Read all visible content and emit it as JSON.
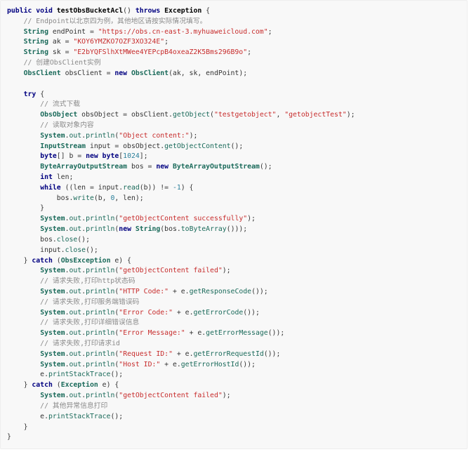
{
  "code": {
    "lines": [
      [
        {
          "t": "public void ",
          "c": "kw"
        },
        {
          "t": "testObsBucketAcl",
          "c": "fn"
        },
        {
          "t": "() ",
          "c": "pl"
        },
        {
          "t": "throws ",
          "c": "kw"
        },
        {
          "t": "Exception",
          "c": "fn"
        },
        {
          "t": " {",
          "c": "pl"
        }
      ],
      [
        {
          "t": "    // Endpoint以北京四为例，其他地区请按实际情况填写。",
          "c": "cmt"
        }
      ],
      [
        {
          "t": "    ",
          "c": "pl"
        },
        {
          "t": "String",
          "c": "ty"
        },
        {
          "t": " endPoint = ",
          "c": "pl"
        },
        {
          "t": "\"https://obs.cn-east-3.myhuaweicloud.com\"",
          "c": "str"
        },
        {
          "t": ";",
          "c": "pl"
        }
      ],
      [
        {
          "t": "    ",
          "c": "pl"
        },
        {
          "t": "String",
          "c": "ty"
        },
        {
          "t": " ak = ",
          "c": "pl"
        },
        {
          "t": "\"KOY6YMZKO7OZF3XO324E\"",
          "c": "str"
        },
        {
          "t": ";",
          "c": "pl"
        }
      ],
      [
        {
          "t": "    ",
          "c": "pl"
        },
        {
          "t": "String",
          "c": "ty"
        },
        {
          "t": " sk = ",
          "c": "pl"
        },
        {
          "t": "\"E2bYQFSlhXtMWee4YEPcpB4oxeaZ2K5Bms296B9o\"",
          "c": "str"
        },
        {
          "t": ";",
          "c": "pl"
        }
      ],
      [
        {
          "t": "    // 创建ObsClient实例",
          "c": "cmt"
        }
      ],
      [
        {
          "t": "    ",
          "c": "pl"
        },
        {
          "t": "ObsClient",
          "c": "ty"
        },
        {
          "t": " obsClient = ",
          "c": "pl"
        },
        {
          "t": "new ",
          "c": "kw"
        },
        {
          "t": "ObsClient",
          "c": "ty"
        },
        {
          "t": "(ak, sk, endPoint);",
          "c": "pl"
        }
      ],
      [
        {
          "t": "",
          "c": "pl"
        }
      ],
      [
        {
          "t": "    ",
          "c": "pl"
        },
        {
          "t": "try",
          "c": "kw"
        },
        {
          "t": " {",
          "c": "pl"
        }
      ],
      [
        {
          "t": "        // 流式下载",
          "c": "cmt"
        }
      ],
      [
        {
          "t": "        ",
          "c": "pl"
        },
        {
          "t": "ObsObject",
          "c": "ty"
        },
        {
          "t": " obsObject = obsClient.",
          "c": "pl"
        },
        {
          "t": "getObject",
          "c": "call"
        },
        {
          "t": "(",
          "c": "pl"
        },
        {
          "t": "\"testgetobject\"",
          "c": "str"
        },
        {
          "t": ", ",
          "c": "pl"
        },
        {
          "t": "\"getobjectTest\"",
          "c": "str"
        },
        {
          "t": ");",
          "c": "pl"
        }
      ],
      [
        {
          "t": "        // 读取对象内容",
          "c": "cmt"
        }
      ],
      [
        {
          "t": "        ",
          "c": "pl"
        },
        {
          "t": "System",
          "c": "ty"
        },
        {
          "t": ".",
          "c": "pl"
        },
        {
          "t": "out",
          "c": "call"
        },
        {
          "t": ".",
          "c": "pl"
        },
        {
          "t": "println",
          "c": "call"
        },
        {
          "t": "(",
          "c": "pl"
        },
        {
          "t": "\"Object content:\"",
          "c": "str"
        },
        {
          "t": ");",
          "c": "pl"
        }
      ],
      [
        {
          "t": "        ",
          "c": "pl"
        },
        {
          "t": "InputStream",
          "c": "ty"
        },
        {
          "t": " input = obsObject.",
          "c": "pl"
        },
        {
          "t": "getObjectContent",
          "c": "call"
        },
        {
          "t": "();",
          "c": "pl"
        }
      ],
      [
        {
          "t": "        ",
          "c": "pl"
        },
        {
          "t": "byte",
          "c": "kw"
        },
        {
          "t": "[] b = ",
          "c": "pl"
        },
        {
          "t": "new byte",
          "c": "kw"
        },
        {
          "t": "[",
          "c": "pl"
        },
        {
          "t": "1024",
          "c": "num"
        },
        {
          "t": "];",
          "c": "pl"
        }
      ],
      [
        {
          "t": "        ",
          "c": "pl"
        },
        {
          "t": "ByteArrayOutputStream",
          "c": "ty"
        },
        {
          "t": " bos = ",
          "c": "pl"
        },
        {
          "t": "new ",
          "c": "kw"
        },
        {
          "t": "ByteArrayOutputStream",
          "c": "ty"
        },
        {
          "t": "();",
          "c": "pl"
        }
      ],
      [
        {
          "t": "        ",
          "c": "pl"
        },
        {
          "t": "int",
          "c": "kw"
        },
        {
          "t": " len;",
          "c": "pl"
        }
      ],
      [
        {
          "t": "        ",
          "c": "pl"
        },
        {
          "t": "while",
          "c": "kw"
        },
        {
          "t": " ((len = input.",
          "c": "pl"
        },
        {
          "t": "read",
          "c": "call"
        },
        {
          "t": "(b)) != ",
          "c": "pl"
        },
        {
          "t": "-1",
          "c": "num"
        },
        {
          "t": ") {",
          "c": "pl"
        }
      ],
      [
        {
          "t": "            bos.",
          "c": "pl"
        },
        {
          "t": "write",
          "c": "call"
        },
        {
          "t": "(b, ",
          "c": "pl"
        },
        {
          "t": "0",
          "c": "num"
        },
        {
          "t": ", len);",
          "c": "pl"
        }
      ],
      [
        {
          "t": "        }",
          "c": "pl"
        }
      ],
      [
        {
          "t": "        ",
          "c": "pl"
        },
        {
          "t": "System",
          "c": "ty"
        },
        {
          "t": ".",
          "c": "pl"
        },
        {
          "t": "out",
          "c": "call"
        },
        {
          "t": ".",
          "c": "pl"
        },
        {
          "t": "println",
          "c": "call"
        },
        {
          "t": "(",
          "c": "pl"
        },
        {
          "t": "\"getObjectContent successfully\"",
          "c": "str"
        },
        {
          "t": ");",
          "c": "pl"
        }
      ],
      [
        {
          "t": "        ",
          "c": "pl"
        },
        {
          "t": "System",
          "c": "ty"
        },
        {
          "t": ".",
          "c": "pl"
        },
        {
          "t": "out",
          "c": "call"
        },
        {
          "t": ".",
          "c": "pl"
        },
        {
          "t": "println",
          "c": "call"
        },
        {
          "t": "(",
          "c": "pl"
        },
        {
          "t": "new ",
          "c": "kw"
        },
        {
          "t": "String",
          "c": "ty"
        },
        {
          "t": "(bos.",
          "c": "pl"
        },
        {
          "t": "toByteArray",
          "c": "call"
        },
        {
          "t": "()));",
          "c": "pl"
        }
      ],
      [
        {
          "t": "        bos.",
          "c": "pl"
        },
        {
          "t": "close",
          "c": "call"
        },
        {
          "t": "();",
          "c": "pl"
        }
      ],
      [
        {
          "t": "        input.",
          "c": "pl"
        },
        {
          "t": "close",
          "c": "call"
        },
        {
          "t": "();",
          "c": "pl"
        }
      ],
      [
        {
          "t": "    } ",
          "c": "pl"
        },
        {
          "t": "catch",
          "c": "kw"
        },
        {
          "t": " (",
          "c": "pl"
        },
        {
          "t": "ObsException",
          "c": "ty"
        },
        {
          "t": " e) {",
          "c": "pl"
        }
      ],
      [
        {
          "t": "        ",
          "c": "pl"
        },
        {
          "t": "System",
          "c": "ty"
        },
        {
          "t": ".",
          "c": "pl"
        },
        {
          "t": "out",
          "c": "call"
        },
        {
          "t": ".",
          "c": "pl"
        },
        {
          "t": "println",
          "c": "call"
        },
        {
          "t": "(",
          "c": "pl"
        },
        {
          "t": "\"getObjectContent failed\"",
          "c": "str"
        },
        {
          "t": ");",
          "c": "pl"
        }
      ],
      [
        {
          "t": "        // 请求失败,打印http状态码",
          "c": "cmt"
        }
      ],
      [
        {
          "t": "        ",
          "c": "pl"
        },
        {
          "t": "System",
          "c": "ty"
        },
        {
          "t": ".",
          "c": "pl"
        },
        {
          "t": "out",
          "c": "call"
        },
        {
          "t": ".",
          "c": "pl"
        },
        {
          "t": "println",
          "c": "call"
        },
        {
          "t": "(",
          "c": "pl"
        },
        {
          "t": "\"HTTP Code:\"",
          "c": "str"
        },
        {
          "t": " + e.",
          "c": "pl"
        },
        {
          "t": "getResponseCode",
          "c": "call"
        },
        {
          "t": "());",
          "c": "pl"
        }
      ],
      [
        {
          "t": "        // 请求失败,打印服务端错误码",
          "c": "cmt"
        }
      ],
      [
        {
          "t": "        ",
          "c": "pl"
        },
        {
          "t": "System",
          "c": "ty"
        },
        {
          "t": ".",
          "c": "pl"
        },
        {
          "t": "out",
          "c": "call"
        },
        {
          "t": ".",
          "c": "pl"
        },
        {
          "t": "println",
          "c": "call"
        },
        {
          "t": "(",
          "c": "pl"
        },
        {
          "t": "\"Error Code:\"",
          "c": "str"
        },
        {
          "t": " + e.",
          "c": "pl"
        },
        {
          "t": "getErrorCode",
          "c": "call"
        },
        {
          "t": "());",
          "c": "pl"
        }
      ],
      [
        {
          "t": "        // 请求失败,打印详细错误信息",
          "c": "cmt"
        }
      ],
      [
        {
          "t": "        ",
          "c": "pl"
        },
        {
          "t": "System",
          "c": "ty"
        },
        {
          "t": ".",
          "c": "pl"
        },
        {
          "t": "out",
          "c": "call"
        },
        {
          "t": ".",
          "c": "pl"
        },
        {
          "t": "println",
          "c": "call"
        },
        {
          "t": "(",
          "c": "pl"
        },
        {
          "t": "\"Error Message:\"",
          "c": "str"
        },
        {
          "t": " + e.",
          "c": "pl"
        },
        {
          "t": "getErrorMessage",
          "c": "call"
        },
        {
          "t": "());",
          "c": "pl"
        }
      ],
      [
        {
          "t": "        // 请求失败,打印请求id",
          "c": "cmt"
        }
      ],
      [
        {
          "t": "        ",
          "c": "pl"
        },
        {
          "t": "System",
          "c": "ty"
        },
        {
          "t": ".",
          "c": "pl"
        },
        {
          "t": "out",
          "c": "call"
        },
        {
          "t": ".",
          "c": "pl"
        },
        {
          "t": "println",
          "c": "call"
        },
        {
          "t": "(",
          "c": "pl"
        },
        {
          "t": "\"Request ID:\"",
          "c": "str"
        },
        {
          "t": " + e.",
          "c": "pl"
        },
        {
          "t": "getErrorRequestId",
          "c": "call"
        },
        {
          "t": "());",
          "c": "pl"
        }
      ],
      [
        {
          "t": "        ",
          "c": "pl"
        },
        {
          "t": "System",
          "c": "ty"
        },
        {
          "t": ".",
          "c": "pl"
        },
        {
          "t": "out",
          "c": "call"
        },
        {
          "t": ".",
          "c": "pl"
        },
        {
          "t": "println",
          "c": "call"
        },
        {
          "t": "(",
          "c": "pl"
        },
        {
          "t": "\"Host ID:\"",
          "c": "str"
        },
        {
          "t": " + e.",
          "c": "pl"
        },
        {
          "t": "getErrorHostId",
          "c": "call"
        },
        {
          "t": "());",
          "c": "pl"
        }
      ],
      [
        {
          "t": "        e.",
          "c": "pl"
        },
        {
          "t": "printStackTrace",
          "c": "call"
        },
        {
          "t": "();",
          "c": "pl"
        }
      ],
      [
        {
          "t": "    } ",
          "c": "pl"
        },
        {
          "t": "catch",
          "c": "kw"
        },
        {
          "t": " (",
          "c": "pl"
        },
        {
          "t": "Exception",
          "c": "ty"
        },
        {
          "t": " e) {",
          "c": "pl"
        }
      ],
      [
        {
          "t": "        ",
          "c": "pl"
        },
        {
          "t": "System",
          "c": "ty"
        },
        {
          "t": ".",
          "c": "pl"
        },
        {
          "t": "out",
          "c": "call"
        },
        {
          "t": ".",
          "c": "pl"
        },
        {
          "t": "println",
          "c": "call"
        },
        {
          "t": "(",
          "c": "pl"
        },
        {
          "t": "\"getObjectContent failed\"",
          "c": "str"
        },
        {
          "t": ");",
          "c": "pl"
        }
      ],
      [
        {
          "t": "        // 其他异常信息打印",
          "c": "cmt"
        }
      ],
      [
        {
          "t": "        e.",
          "c": "pl"
        },
        {
          "t": "printStackTrace",
          "c": "call"
        },
        {
          "t": "();",
          "c": "pl"
        }
      ],
      [
        {
          "t": "    }",
          "c": "pl"
        }
      ],
      [
        {
          "t": "}",
          "c": "pl"
        }
      ]
    ]
  },
  "colors": {
    "background": "#f8f8f8",
    "keyword": "#000080",
    "string": "#c72c2c",
    "number": "#2a7f9a",
    "comment": "#8a8a8a",
    "type": "#1a6a5a",
    "text": "#333333"
  }
}
